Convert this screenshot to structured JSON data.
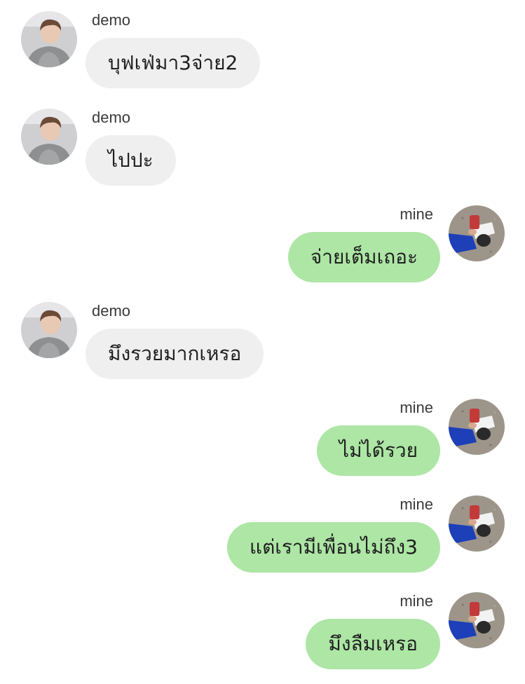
{
  "colors": {
    "background": "#ffffff",
    "incoming_bubble": "#efefef",
    "outgoing_bubble": "#ade6a5",
    "name_text": "#3a3a3a"
  },
  "messages": [
    {
      "side": "incoming",
      "sender": "demo",
      "avatar": "demo-avatar",
      "text": "บุฟเฟ่มา3จ่าย2"
    },
    {
      "side": "incoming",
      "sender": "demo",
      "avatar": "demo-avatar",
      "text": "ไปปะ"
    },
    {
      "side": "outgoing",
      "sender": "mine",
      "avatar": "mine-avatar",
      "text": "จ่ายเต็มเถอะ"
    },
    {
      "side": "incoming",
      "sender": "demo",
      "avatar": "demo-avatar",
      "text": "มึงรวยมากเหรอ"
    },
    {
      "side": "outgoing",
      "sender": "mine",
      "avatar": "mine-avatar",
      "text": "ไม่ได้รวย"
    },
    {
      "side": "outgoing",
      "sender": "mine",
      "avatar": "mine-avatar",
      "text": "แต่เรามีเพื่อนไม่ถึง3"
    },
    {
      "side": "outgoing",
      "sender": "mine",
      "avatar": "mine-avatar",
      "text": "มึงลืมเหรอ"
    }
  ]
}
